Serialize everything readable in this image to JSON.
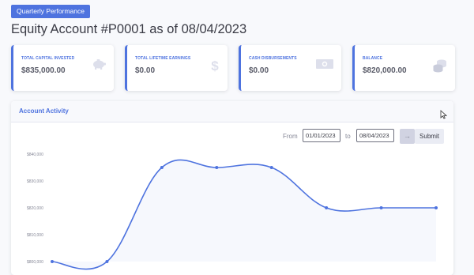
{
  "header": {
    "quarterly_button": "Quarterly Performance",
    "title": "Equity Account #P0001 as of 08/04/2023"
  },
  "cards": [
    {
      "label": "TOTAL CAPITAL INVESTED",
      "value": "$835,000.00",
      "icon": "piggy-bank-icon"
    },
    {
      "label": "TOTAL LIFETIME EARNINGS",
      "value": "$0.00",
      "icon": "dollar-sign-icon"
    },
    {
      "label": "CASH DISBURSEMENTS",
      "value": "$0.00",
      "icon": "money-bill-icon"
    },
    {
      "label": "BALANCE",
      "value": "$820,000.00",
      "icon": "coins-icon"
    }
  ],
  "activity": {
    "title": "Account Activity",
    "from_label": "From",
    "from_value": "01/01/2023",
    "to_label": "to",
    "to_value": "08/04/2023",
    "go_icon": "arrow-right-icon",
    "submit_label": "Submit"
  },
  "colors": {
    "accent": "#4e73df"
  },
  "chart_data": {
    "type": "line",
    "y_ticks": [
      "$840,000",
      "$830,000",
      "$820,000",
      "$810,000",
      "$800,000"
    ],
    "ylim": [
      800000,
      840000
    ],
    "values": [
      800000,
      800000,
      835000,
      835000,
      835000,
      820000,
      820000,
      820000
    ],
    "grid": false,
    "fill": true,
    "line_color": "#4e73df"
  }
}
